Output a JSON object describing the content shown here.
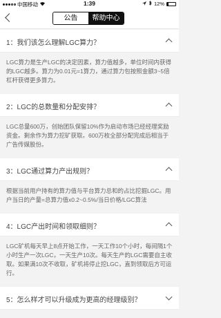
{
  "status": {
    "carrier": "中国移动",
    "time": "1:39",
    "battery": "12%"
  },
  "nav": {
    "tab_announcement": "公告",
    "tab_help": "帮助中心",
    "active_tab": "帮助中心"
  },
  "faqs": [
    {
      "question": "1：我们该怎么理解LGC算力？",
      "answer": "LGC算力是生产LGC的决定因素，算力值越多，单位时间内获得的LGC越多。算力为0.01元=1算力，通过算力包按照金额3~5倍杠杆获得更多算力。",
      "expanded": true
    },
    {
      "question": "2：LGC的总数量和分配安排？",
      "answer": "LGC总量600万，创始团队保留10%作为启动市场已经经理奖励资金。剩余作为算力挖矿获取。600万枚全部分配完成后相当于广告传媒股份。",
      "expanded": true
    },
    {
      "question": "3：LGC通过算力产出规则？",
      "answer": "根据当前用户持有的算力值与平台算力总和的占比挖掘LGC。用户当日的产量=总算力值x0.2~0.5%/当日价格/LGC算法",
      "expanded": true
    },
    {
      "question": "4：LGC产出时间和领取细则？",
      "answer": "LGC矿机每天早上8点开始工作，一天工作10个小时，每间隔1个小时生产一次LGC，一天生产10次。每天生产的LGC需要自主收取。如果满10次不收取，矿机将停止挖LGC，直到领取后方可运行。",
      "expanded": true
    },
    {
      "question": "5：怎么样才可以升级成为更高的经理级别？",
      "answer": "",
      "expanded": false
    }
  ]
}
